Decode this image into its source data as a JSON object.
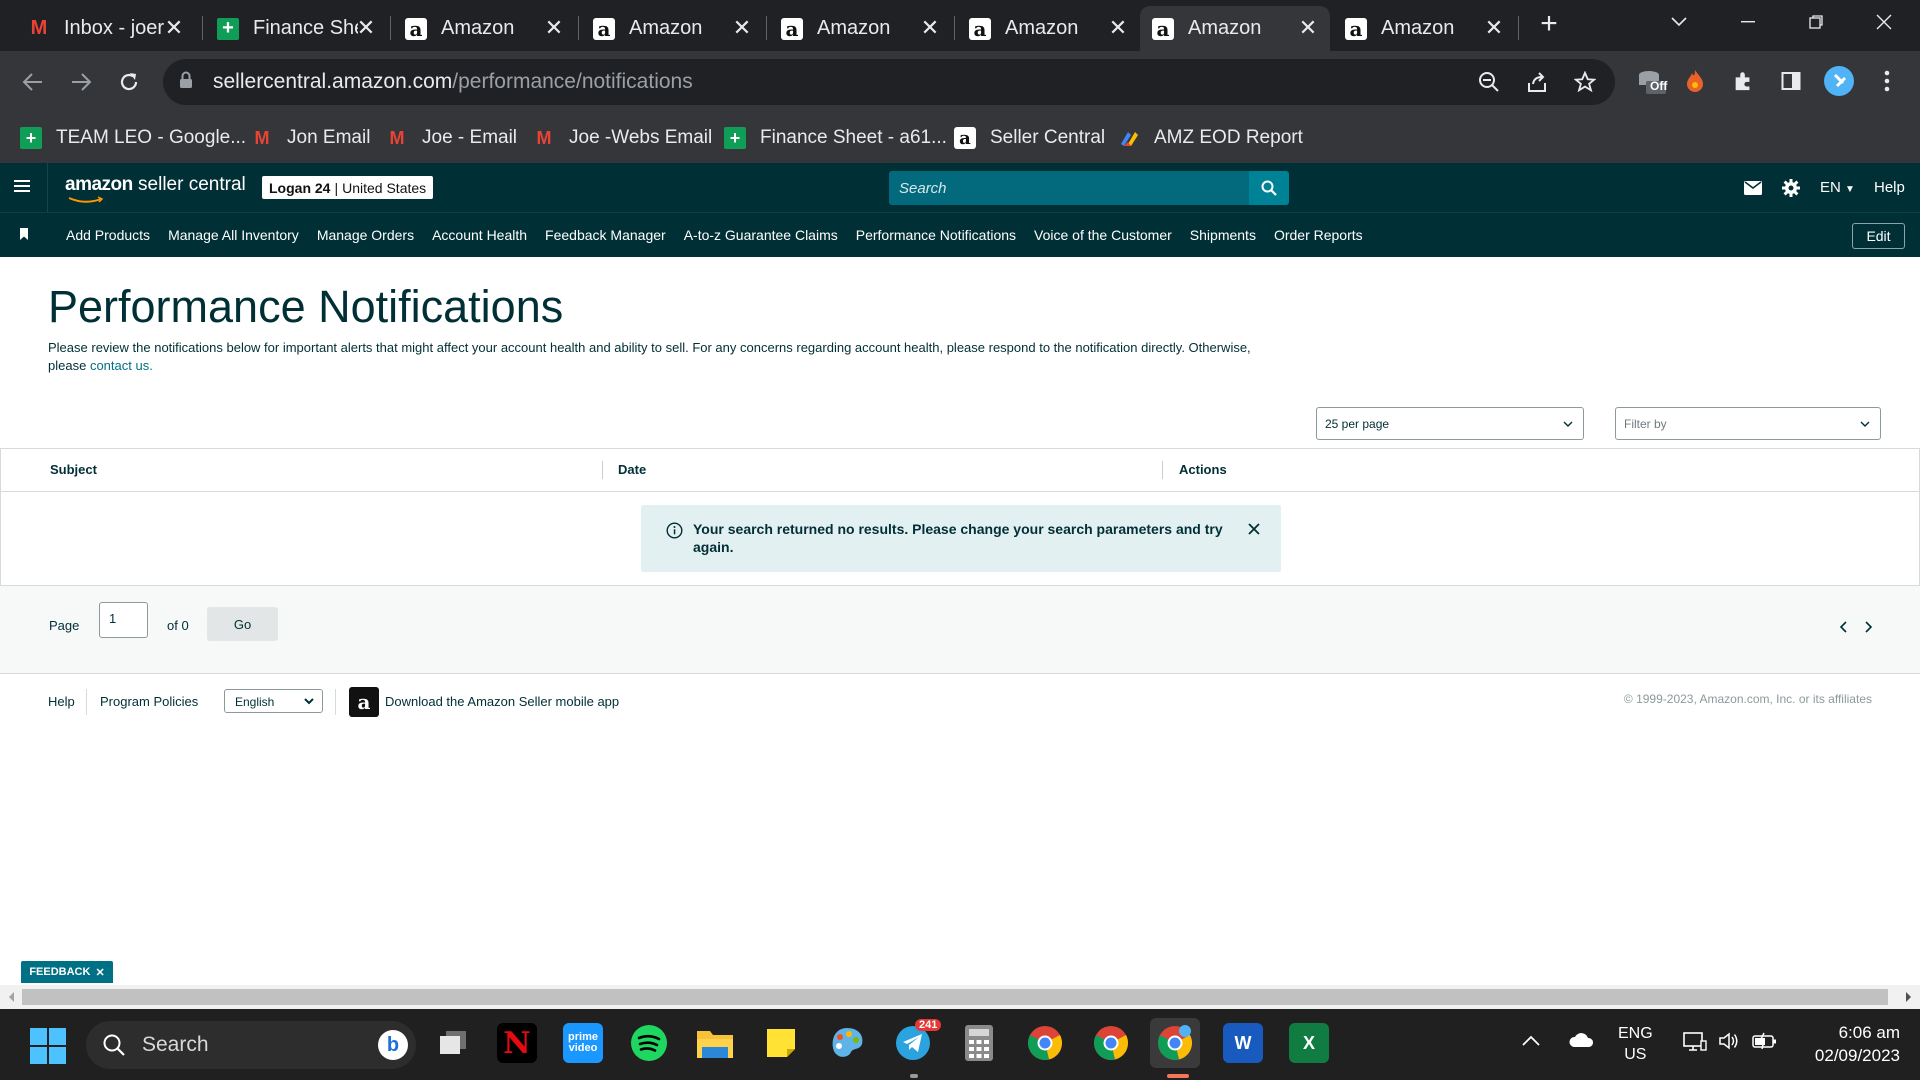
{
  "browser": {
    "tabs": [
      {
        "title": "Inbox - joer",
        "icon": "gmail-icon"
      },
      {
        "title": "Finance She",
        "icon": "sheets-icon"
      },
      {
        "title": "Amazon",
        "icon": "amazon-icon"
      },
      {
        "title": "Amazon",
        "icon": "amazon-icon"
      },
      {
        "title": "Amazon",
        "icon": "amazon-icon"
      },
      {
        "title": "Amazon",
        "icon": "amazon-icon"
      },
      {
        "title": "Amazon",
        "icon": "amazon-icon",
        "active": true
      },
      {
        "title": "Amazon",
        "icon": "amazon-icon"
      }
    ],
    "url_host": "sellercentral.amazon.com",
    "url_path": "/performance/notifications",
    "ext_badge": "Off",
    "bookmarks": [
      {
        "label": "TEAM LEO - Google...",
        "icon": "sheets-icon"
      },
      {
        "label": "Jon Email",
        "icon": "gmail-icon"
      },
      {
        "label": "Joe - Email",
        "icon": "gmail-icon"
      },
      {
        "label": "Joe -Webs Email",
        "icon": "gmail-icon"
      },
      {
        "label": "Finance Sheet - a61...",
        "icon": "sheets-icon"
      },
      {
        "label": "Seller Central",
        "icon": "amazon-icon"
      },
      {
        "label": "AMZ EOD Report",
        "icon": "report-icon"
      }
    ]
  },
  "header": {
    "logo_bold": "amazon",
    "logo_rest": " seller central",
    "store_name": "Logan 24",
    "store_sep": "|",
    "store_region": "United States",
    "search_placeholder": "Search",
    "language": "EN",
    "help": "Help"
  },
  "nav": {
    "links": [
      "Add Products",
      "Manage All Inventory",
      "Manage Orders",
      "Account Health",
      "Feedback Manager",
      "A-to-z Guarantee Claims",
      "Performance Notifications",
      "Voice of the Customer",
      "Shipments",
      "Order Reports"
    ],
    "edit": "Edit"
  },
  "page": {
    "title": "Performance Notifications",
    "description": "Please review the notifications below for important alerts that might affect your account health and ability to sell. For any concerns regarding account health, please respond to the notification directly. Otherwise, please",
    "contact_link": "contact us.",
    "per_page": "25 per page",
    "filter_placeholder": "Filter by",
    "columns": [
      "Subject",
      "Date",
      "Actions"
    ],
    "no_results": "Your search returned no results. Please change your search parameters and try again.",
    "pager": {
      "page_label": "Page",
      "current": "1",
      "of_label": "of 0",
      "go": "Go"
    }
  },
  "footer": {
    "help": "Help",
    "policies": "Program Policies",
    "language": "English",
    "app_link": "Download the Amazon Seller mobile app",
    "copyright": "© 1999-2023, Amazon.com, Inc. or its affiliates",
    "feedback": "FEEDBACK"
  },
  "taskbar": {
    "search": "Search",
    "telegram_badge": "241",
    "lang_top": "ENG",
    "lang_bottom": "US",
    "time": "6:06 am",
    "date": "02/09/2023"
  },
  "colors": {
    "header_bg": "#002f36",
    "link": "#007185",
    "search_bg": "#036a7e",
    "alert_bg": "#e3f0f1"
  }
}
